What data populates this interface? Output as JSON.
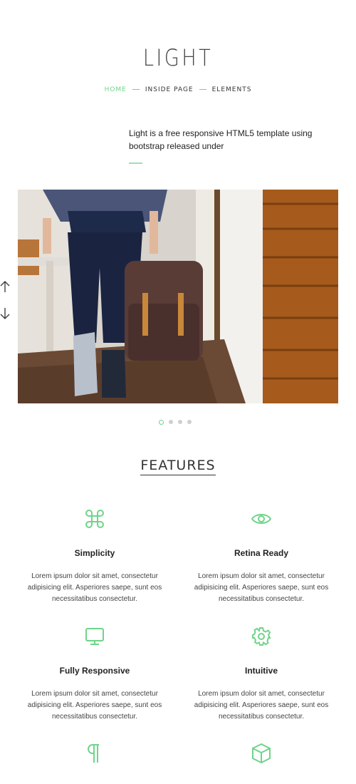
{
  "site": {
    "logo": "LIGHT"
  },
  "nav": {
    "items": [
      "HOME",
      "INSIDE PAGE",
      "ELEMENTS"
    ]
  },
  "intro": {
    "text": "Light is a free responsive HTML5 template using bootstrap released under"
  },
  "slider": {
    "slide_count": 4,
    "active_index": 0
  },
  "features": {
    "title": "FEATURES",
    "items": [
      {
        "icon": "command-icon",
        "name": "Simplicity",
        "desc": "Lorem ipsum dolor sit amet, consectetur adipisicing elit. Asperiores saepe, sunt eos necessitatibus consectetur."
      },
      {
        "icon": "eye-icon",
        "name": "Retina Ready",
        "desc": "Lorem ipsum dolor sit amet, consectetur adipisicing elit. Asperiores saepe, sunt eos necessitatibus consectetur."
      },
      {
        "icon": "monitor-icon",
        "name": "Fully Responsive",
        "desc": "Lorem ipsum dolor sit amet, consectetur adipisicing elit. Asperiores saepe, sunt eos necessitatibus consectetur."
      },
      {
        "icon": "gear-icon",
        "name": "Intuitive",
        "desc": "Lorem ipsum dolor sit amet, consectetur adipisicing elit. Asperiores saepe, sunt eos necessitatibus consectetur."
      },
      {
        "icon": "pilcrow-icon",
        "name": "",
        "desc": ""
      },
      {
        "icon": "cube-icon",
        "name": "",
        "desc": ""
      }
    ]
  },
  "colors": {
    "accent": "#6fd48a",
    "text": "#333333"
  }
}
